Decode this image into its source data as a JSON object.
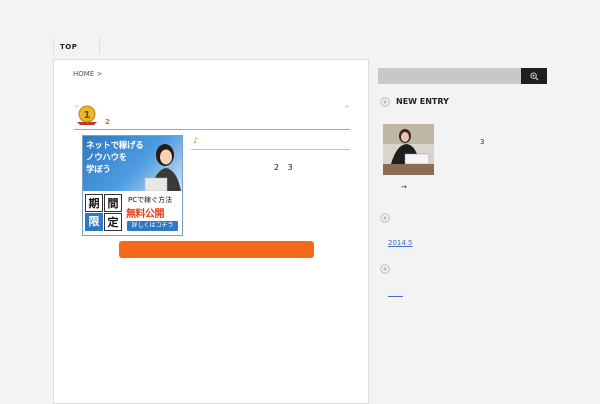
{
  "nav": {
    "top_tab": "TOP"
  },
  "breadcrumb": {
    "home": "HOME >"
  },
  "article": {
    "rank_number": "1",
    "rank_second": "2",
    "note_symbol": "♪",
    "nums": "2 3",
    "quote_open": "〃",
    "quote_close": "〃"
  },
  "banner": {
    "line1": "ネットで稼げる",
    "line2": "ノウハウを",
    "line3": "学ぼう",
    "kanji": [
      "期",
      "間",
      "限",
      "定"
    ],
    "pc_text": "PCで稼ぐ方法",
    "free_text": "無料公開",
    "detail_label": "詳しくはコチラ"
  },
  "sidebar": {
    "new_entry_heading": "NEW ENTRY",
    "entry_count": "3",
    "arrow": "→",
    "archive_label": "2014 5"
  },
  "colors": {
    "accent_orange": "#f46a1a",
    "link_blue": "#3a6fc4",
    "banner_blue": "#2d79c3",
    "search_dark": "#1e1e1e"
  },
  "icons": {
    "search": "magnifier-icon",
    "section": "circle-bullet-icon",
    "rank": "first-place-ribbon-icon"
  }
}
